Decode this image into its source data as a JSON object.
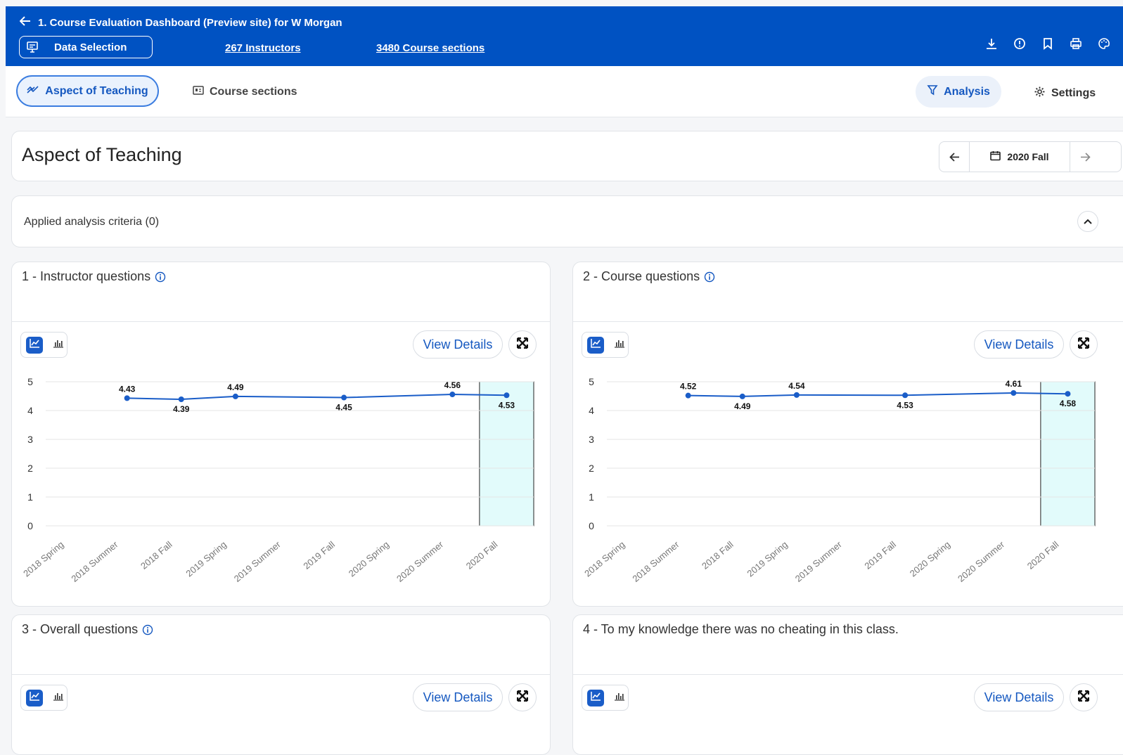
{
  "header": {
    "title": "1. Course Evaluation Dashboard (Preview site) for W Morgan",
    "data_selection_label": "Data Selection",
    "instructors_link": "267 Instructors",
    "sections_link": "3480 Course sections"
  },
  "tabs": {
    "aspect_label": "Aspect of Teaching",
    "sections_label": "Course sections",
    "analysis_label": "Analysis",
    "settings_label": "Settings"
  },
  "page": {
    "title": "Aspect of Teaching",
    "term": "2020 Fall",
    "criteria_label": "Applied analysis criteria (0)"
  },
  "panels": [
    {
      "title": "1 - Instructor questions",
      "view_details": "View Details"
    },
    {
      "title": "2 - Course questions",
      "view_details": "View Details"
    },
    {
      "title": "3 - Overall questions",
      "view_details": "View Details"
    },
    {
      "title": "4 - To my knowledge there was no cheating in this class.",
      "view_details": "View Details"
    }
  ],
  "colors": {
    "brand": "#0052c2",
    "line": "#1a5dc8",
    "highlight": "#e2fbfb"
  },
  "chart_data": [
    {
      "type": "line",
      "categories": [
        "2018 Spring",
        "2018 Summer",
        "2018 Fall",
        "2019 Spring",
        "2019 Summer",
        "2019 Fall",
        "2020 Spring",
        "2020 Summer",
        "2020 Fall"
      ],
      "values": [
        null,
        4.43,
        4.39,
        4.49,
        null,
        4.45,
        null,
        4.56,
        4.53
      ],
      "data_labels": [
        "",
        "4.43",
        "4.39",
        "4.49",
        "",
        "4.45",
        "",
        "4.56",
        "4.53"
      ],
      "yticks": [
        "0",
        "1",
        "2",
        "3",
        "4",
        "5"
      ],
      "ylim": [
        0,
        5
      ],
      "highlight_category": "2020 Fall",
      "grid": true
    },
    {
      "type": "line",
      "categories": [
        "2018 Spring",
        "2018 Summer",
        "2018 Fall",
        "2019 Spring",
        "2019 Summer",
        "2019 Fall",
        "2020 Spring",
        "2020 Summer",
        "2020 Fall"
      ],
      "values": [
        null,
        4.52,
        4.49,
        4.54,
        null,
        4.53,
        null,
        4.61,
        4.58
      ],
      "data_labels": [
        "",
        "4.52",
        "4.49",
        "4.54",
        "",
        "4.53",
        "",
        "4.61",
        "4.58"
      ],
      "yticks": [
        "0",
        "1",
        "2",
        "3",
        "4",
        "5"
      ],
      "ylim": [
        0,
        5
      ],
      "highlight_category": "2020 Fall",
      "grid": true
    }
  ]
}
